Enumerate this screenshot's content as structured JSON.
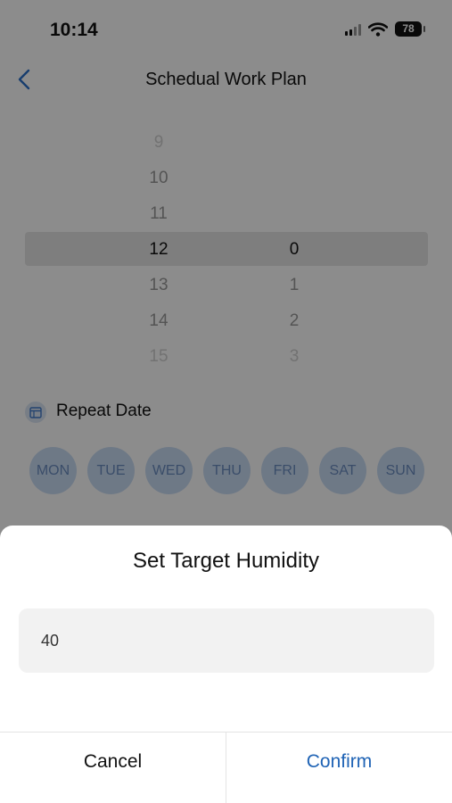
{
  "status_bar": {
    "time": "10:14",
    "battery": "78"
  },
  "header": {
    "title": "Schedual Work Plan"
  },
  "picker": {
    "hours": [
      "9",
      "10",
      "11",
      "12",
      "13",
      "14",
      "15"
    ],
    "minutes": [
      "0",
      "1",
      "2",
      "3"
    ],
    "selected_hour": "12",
    "selected_minute": "0"
  },
  "repeat": {
    "label": "Repeat Date",
    "days": [
      "MON",
      "TUE",
      "WED",
      "THU",
      "FRI",
      "SAT",
      "SUN"
    ]
  },
  "dialog": {
    "title": "Set Target Humidity",
    "input_value": "40",
    "cancel_label": "Cancel",
    "confirm_label": "Confirm"
  },
  "colors": {
    "accent": "#1f63b5",
    "day_chip_bg": "#c9dcf5"
  }
}
